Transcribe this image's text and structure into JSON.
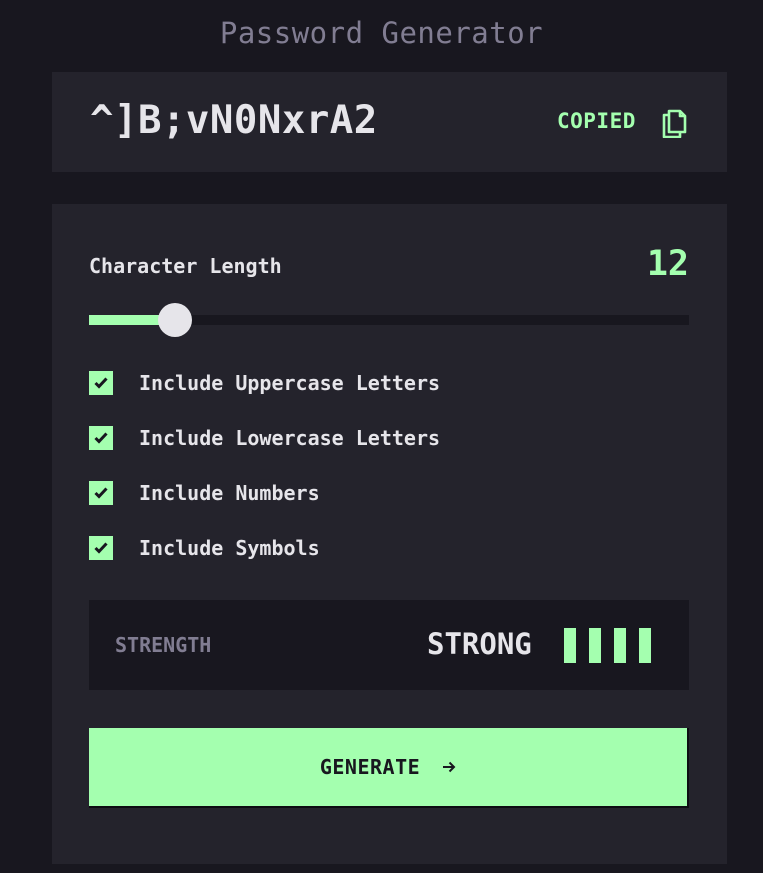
{
  "app": {
    "title": "Password Generator"
  },
  "password": {
    "value": "^]B;vN0NxrA2",
    "copied_label": "COPIED",
    "copy_icon": "copy-icon"
  },
  "length": {
    "label": "Character Length",
    "value": "12",
    "slider_fraction": 0.143
  },
  "options": [
    {
      "label": "Include Uppercase Letters",
      "checked": true
    },
    {
      "label": "Include Lowercase Letters",
      "checked": true
    },
    {
      "label": "Include Numbers",
      "checked": true
    },
    {
      "label": "Include Symbols",
      "checked": true
    }
  ],
  "strength": {
    "label": "STRENGTH",
    "value": "STRONG",
    "bars_filled": 4,
    "bars_total": 4
  },
  "generate": {
    "label": "GENERATE",
    "icon": "arrow-right-icon"
  },
  "colors": {
    "background": "#18171f",
    "panel": "#24232c",
    "accent": "#a4ffaf",
    "text": "#e6e5ea",
    "muted": "#817d92"
  }
}
